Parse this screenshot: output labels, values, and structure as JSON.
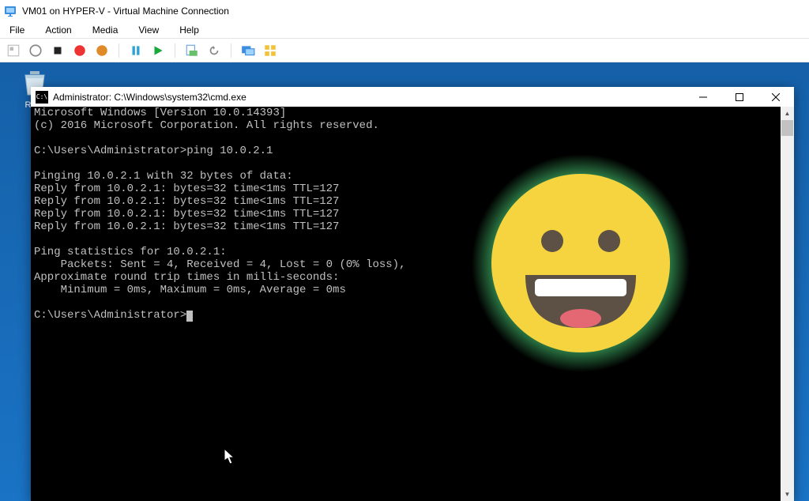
{
  "outer": {
    "title": "VM01 on HYPER-V - Virtual Machine Connection",
    "menu": {
      "file": "File",
      "action": "Action",
      "media": "Media",
      "view": "View",
      "help": "Help"
    }
  },
  "desktop": {
    "recycle_label": "Recycle Bin",
    "recycle_label_short": "Recy"
  },
  "cmd": {
    "title": "Administrator: C:\\Windows\\system32\\cmd.exe",
    "lines": {
      "l0": "Microsoft Windows [Version 10.0.14393]",
      "l1": "(c) 2016 Microsoft Corporation. All rights reserved.",
      "l2": "",
      "l3": "C:\\Users\\Administrator>ping 10.0.2.1",
      "l4": "",
      "l5": "Pinging 10.0.2.1 with 32 bytes of data:",
      "l6": "Reply from 10.0.2.1: bytes=32 time<1ms TTL=127",
      "l7": "Reply from 10.0.2.1: bytes=32 time<1ms TTL=127",
      "l8": "Reply from 10.0.2.1: bytes=32 time<1ms TTL=127",
      "l9": "Reply from 10.0.2.1: bytes=32 time<1ms TTL=127",
      "l10": "",
      "l11": "Ping statistics for 10.0.2.1:",
      "l12": "    Packets: Sent = 4, Received = 4, Lost = 0 (0% loss),",
      "l13": "Approximate round trip times in milli-seconds:",
      "l14": "    Minimum = 0ms, Maximum = 0ms, Average = 0ms",
      "l15": "",
      "l16": "C:\\Users\\Administrator>"
    }
  },
  "colors": {
    "emoji_face": "#f5d43f",
    "emoji_dark": "#5d5044",
    "emoji_mouth_dark": "#a7484e",
    "emoji_tongue": "#e46874",
    "emoji_glow": "#4dd67a"
  }
}
